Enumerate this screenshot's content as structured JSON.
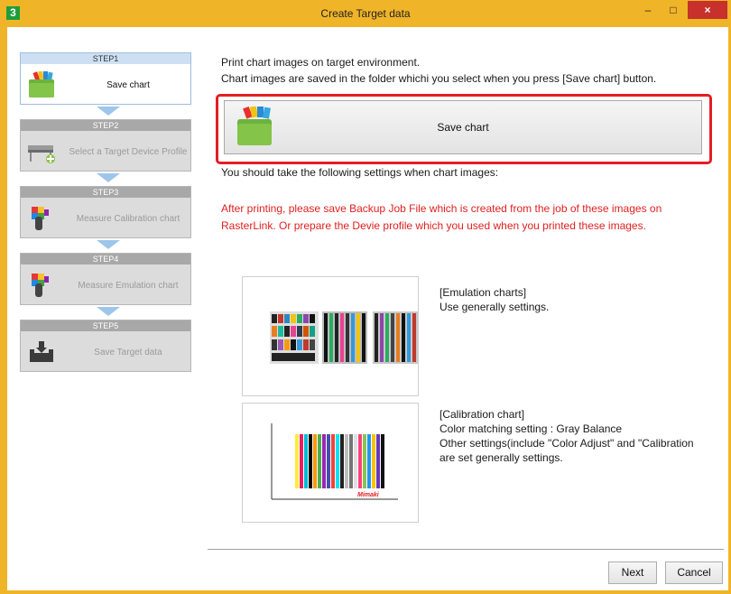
{
  "window": {
    "title": "Create Target data",
    "app_icon": "3",
    "minimize_label": "–",
    "maximize_label": "□",
    "close_label": "×"
  },
  "steps": [
    {
      "header": "STEP1",
      "label": "Save chart",
      "icon": "folder-chart-icon",
      "active": true
    },
    {
      "header": "STEP2",
      "label": "Select a Target Device Profile",
      "icon": "printer-icon",
      "active": false
    },
    {
      "header": "STEP3",
      "label": "Measure Calibration chart",
      "icon": "colorimeter-icon",
      "active": false
    },
    {
      "header": "STEP4",
      "label": "Measure Emulation chart",
      "icon": "colorimeter-icon",
      "active": false
    },
    {
      "header": "STEP5",
      "label": "Save Target data",
      "icon": "save-tray-icon",
      "active": false
    }
  ],
  "main": {
    "intro_line1": "Print chart images on target environment.",
    "intro_line2": "Chart images are saved in the folder whichi you select when you press [Save chart] button.",
    "save_button_label": "Save chart",
    "settings_heading": "You should take the following settings when chart images:",
    "warning_text": "After printing, please save Backup Job File which is created from the job of these images on RasterLink. Or prepare the Devie profile which you used when you printed these images.",
    "emulation": {
      "title": "[Emulation charts]",
      "line1": "Use generally settings."
    },
    "calibration": {
      "title": "[Calibration chart]",
      "line1": "Color matching setting : Gray Balance",
      "line2": "Other settings(include \"Color Adjust\" and \"Calibration",
      "line3": " are set generally settings.",
      "thumb_brand": "Mimaki"
    }
  },
  "footer": {
    "next_label": "Next",
    "cancel_label": "Cancel"
  },
  "colors": {
    "title_bar": "#f0b429",
    "highlight": "#e31e24",
    "warning_text": "#e02020",
    "active_step_header": "#cde0f3",
    "step_arrow": "#9ec6ea"
  }
}
